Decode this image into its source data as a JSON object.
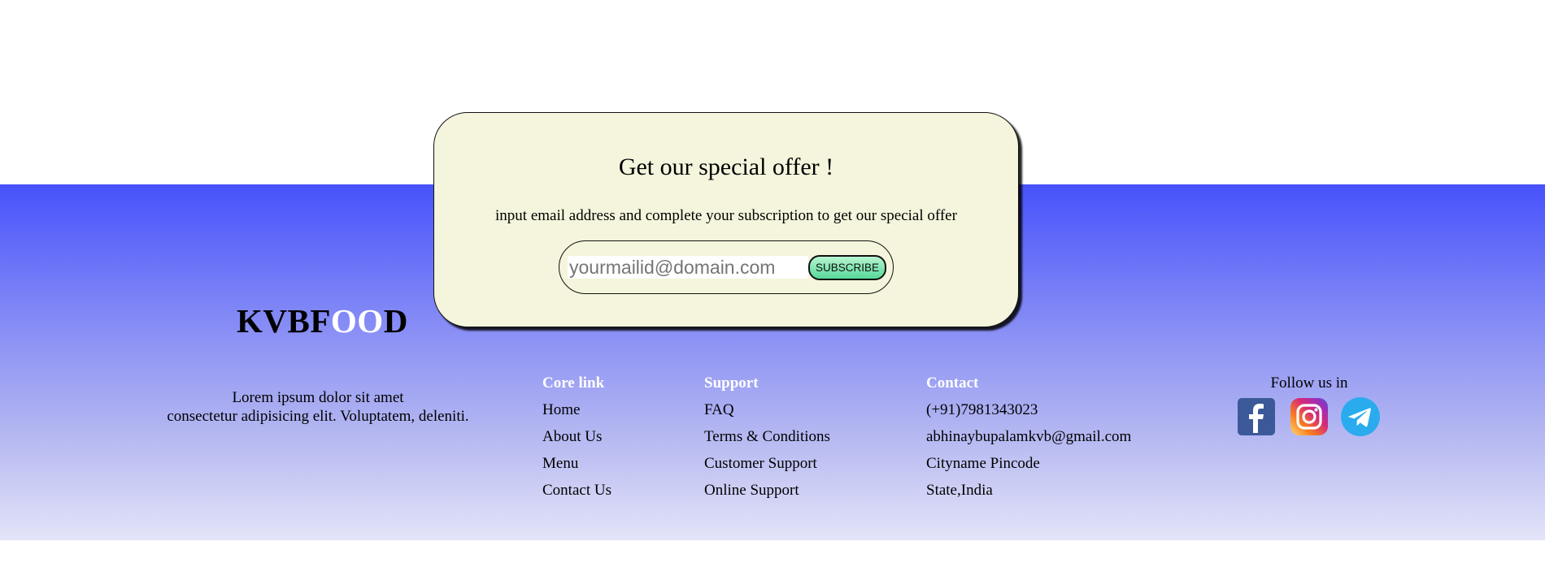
{
  "offer": {
    "title": "Get our special offer !",
    "subtitle": "input email address and complete your subscription to get our special offer",
    "email_placeholder": "yourmailid@domain.com",
    "subscribe_label": "SUBSCRIBE"
  },
  "brand": {
    "part1": "KVBF",
    "part2": "OO",
    "part3": "D"
  },
  "about": {
    "line1": "Lorem ipsum dolor sit amet",
    "line2": "consectetur adipisicing elit. Voluptatem, deleniti."
  },
  "columns": {
    "core": {
      "title": "Core link",
      "items": [
        "Home",
        "About Us",
        "Menu",
        "Contact Us"
      ]
    },
    "support": {
      "title": "Support",
      "items": [
        "FAQ",
        "Terms & Conditions",
        "Customer Support",
        "Online Support"
      ]
    },
    "contact": {
      "title": "Contact",
      "items": [
        "(+91)7981343023",
        "abhinaybupalamkvb@gmail.com",
        "Cityname Pincode",
        "State,India"
      ]
    }
  },
  "follow": {
    "title": "Follow us in",
    "icons": [
      "facebook-icon",
      "instagram-icon",
      "telegram-icon"
    ]
  },
  "colors": {
    "footer_top": "#4752fb",
    "footer_bottom": "#e3e4f8",
    "card_bg": "#f4f5dc",
    "subscribe_btn": "#56d89a",
    "facebook": "#3b5998",
    "telegram": "#2aabee"
  }
}
